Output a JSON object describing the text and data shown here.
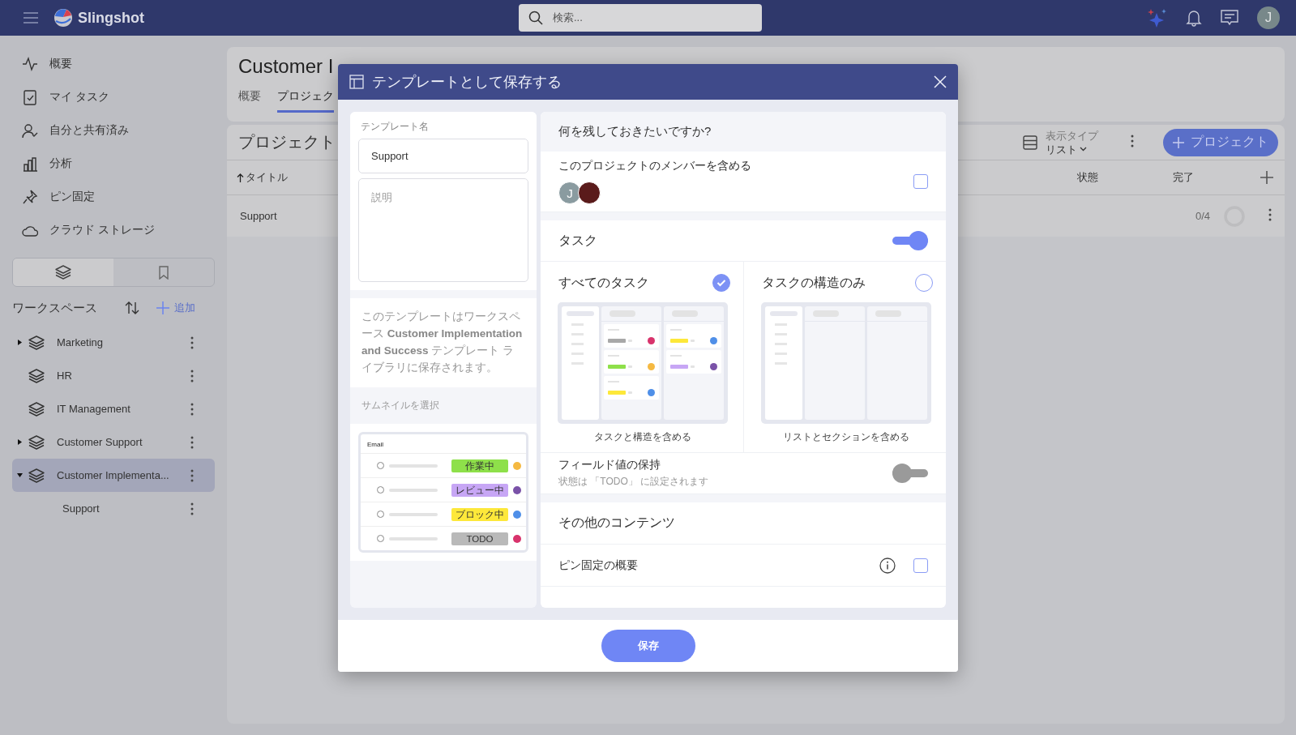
{
  "topbar": {
    "app_name": "Slingshot",
    "search": {
      "placeholder": "検索..."
    },
    "avatar": "J"
  },
  "sidebar": {
    "nav": [
      {
        "label": "概要"
      },
      {
        "label": "マイ タスク"
      },
      {
        "label": "自分と共有済み"
      },
      {
        "label": "分析"
      },
      {
        "label": "ピン固定"
      },
      {
        "label": "クラウド ストレージ"
      }
    ],
    "view_switch": [
      {
        "selected": true
      },
      {
        "selected": false
      }
    ],
    "workspaces": {
      "title": "ワークスペース",
      "add_label": "追加",
      "items": [
        {
          "label": "Marketing",
          "has_children": true,
          "expanded": false,
          "selected": false
        },
        {
          "label": "HR",
          "has_children": false,
          "expanded": false,
          "selected": false
        },
        {
          "label": "IT Management",
          "has_children": false,
          "expanded": false,
          "selected": false
        },
        {
          "label": "Customer Support",
          "has_children": true,
          "expanded": false,
          "selected": false
        },
        {
          "label": "Customer Implementa...",
          "has_children": true,
          "expanded": true,
          "selected": true,
          "children": [
            {
              "label": "Support",
              "has_children": false,
              "expanded": false,
              "selected": false
            }
          ]
        }
      ]
    }
  },
  "page": {
    "title": "Customer I",
    "tabs": [
      {
        "label": "概要",
        "selected": false
      },
      {
        "label": "プロジェク",
        "selected": true
      }
    ]
  },
  "projects": {
    "title": "プロジェクト",
    "view_type_label": "表示タイプ",
    "view_type_value": "リスト",
    "new_button": "プロジェクト",
    "columns": [
      "タイトル",
      "状態",
      "完了"
    ],
    "rows": [
      {
        "title": "Support",
        "progress": "0/4",
        "level": 0
      }
    ]
  },
  "dialog": {
    "title": "テンプレートとして保存する",
    "name_label": "テンプレート名",
    "name_value": "Support",
    "description_placeholder": "説明",
    "info_text": "このテンプレートはワークスペース **Customer Implementation and Success** テンプレート ライブラリに保存されます。",
    "thumbnail_label": "サムネイルを選択",
    "thumbnail": {
      "title": "Email",
      "rows": [
        {
          "status": "作業中",
          "color": "#8ee04a"
        },
        {
          "status": "レビュー中",
          "color": "#c7a6f5"
        },
        {
          "status": "ブロック中",
          "color": "#fde83a"
        },
        {
          "status": "TODO",
          "color": "#b9b9b9"
        }
      ]
    },
    "question": "何を残しておきたいですか?",
    "members": {
      "label": "このプロジェクトのメンバーを含める",
      "checked": false,
      "avatars": [
        {
          "kind": "initial",
          "text": "J"
        },
        {
          "kind": "photo"
        }
      ]
    },
    "tasks": {
      "label": "タスク",
      "on": true,
      "options": [
        {
          "kind": "full",
          "label": "すべてのタスク",
          "caption": "タスクと構造を含める",
          "selected": true
        },
        {
          "kind": "structure",
          "label": "タスクの構造のみ",
          "caption": "リストとセクションを含める",
          "selected": false
        }
      ]
    },
    "field_values": {
      "label": "フィールド値の保持",
      "description": "状態は 「TODO」 に設定されます",
      "on": false
    },
    "other_content": {
      "title": "その他のコンテンツ",
      "items": [
        {
          "label": "ピン固定の概要",
          "checked": false
        }
      ]
    },
    "save_button": "保存"
  }
}
